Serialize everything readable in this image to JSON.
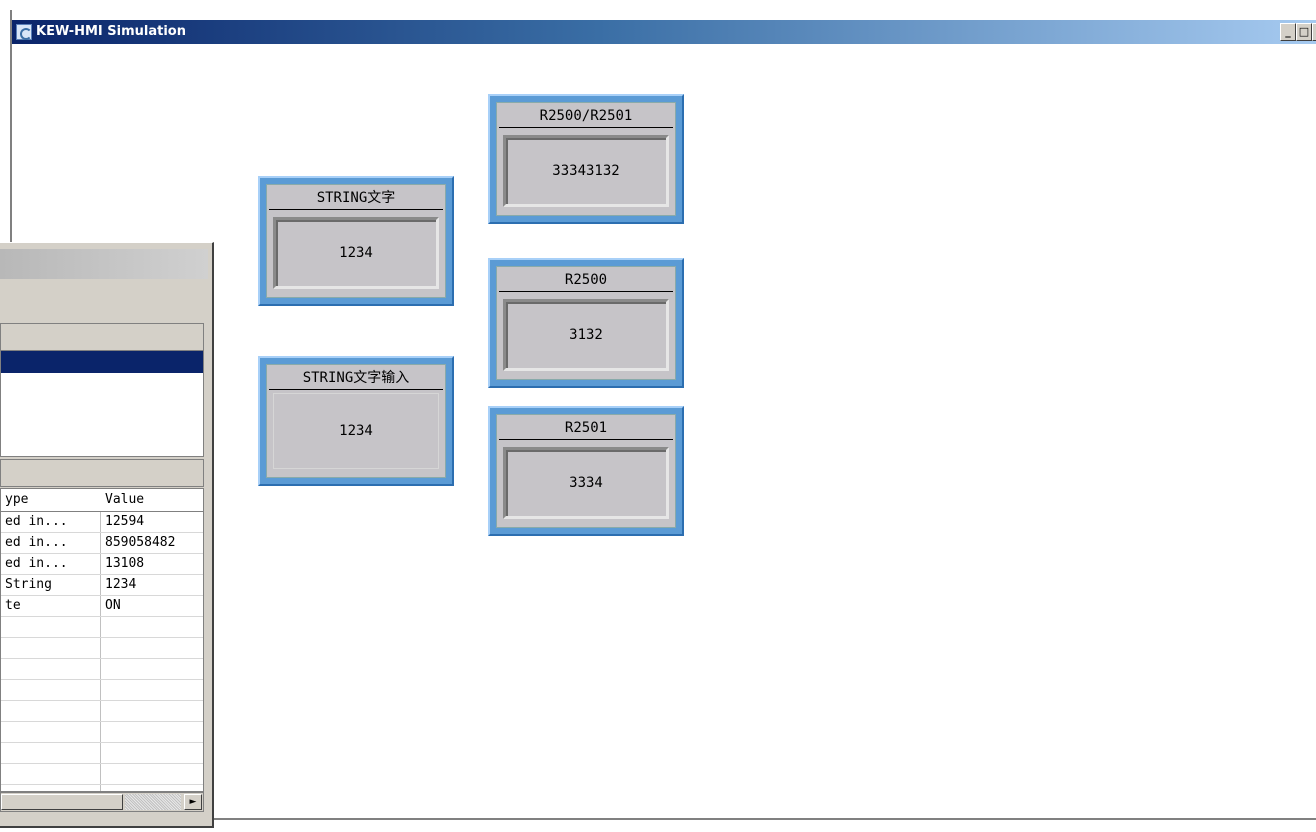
{
  "window": {
    "title": "KEW-HMI Simulation",
    "buttons": {
      "minimize": "_",
      "maximize": "□",
      "close": "×"
    }
  },
  "variable_table": {
    "columns": [
      "ype",
      "Value"
    ],
    "rows": [
      {
        "type": "ed in...",
        "value": "12594"
      },
      {
        "type": "ed in...",
        "value": "859058482"
      },
      {
        "type": "ed in...",
        "value": "13108"
      },
      {
        "type": "String",
        "value": "1234"
      },
      {
        "type": "te",
        "value": "ON"
      },
      {
        "type": "",
        "value": ""
      },
      {
        "type": "",
        "value": ""
      },
      {
        "type": "",
        "value": ""
      },
      {
        "type": "",
        "value": ""
      },
      {
        "type": "",
        "value": ""
      },
      {
        "type": "",
        "value": ""
      },
      {
        "type": "",
        "value": ""
      },
      {
        "type": "",
        "value": ""
      }
    ]
  },
  "widgets": {
    "r2500_r2501": {
      "title": "R2500/R2501",
      "value": "33343132"
    },
    "string_text": {
      "title": "STRING文字",
      "value": "1234"
    },
    "r2500": {
      "title": "R2500",
      "value": "3132"
    },
    "string_text_input": {
      "title": "STRING文字输入",
      "value": "1234"
    },
    "r2501": {
      "title": "R2501",
      "value": "3334"
    }
  },
  "colors": {
    "titlebar_start": "#0a246a",
    "titlebar_end": "#a6caf0",
    "widget_frame": "#5b9bd5",
    "widget_face": "#c6c4c8"
  },
  "scrollbar": {
    "right_arrow": "►"
  }
}
